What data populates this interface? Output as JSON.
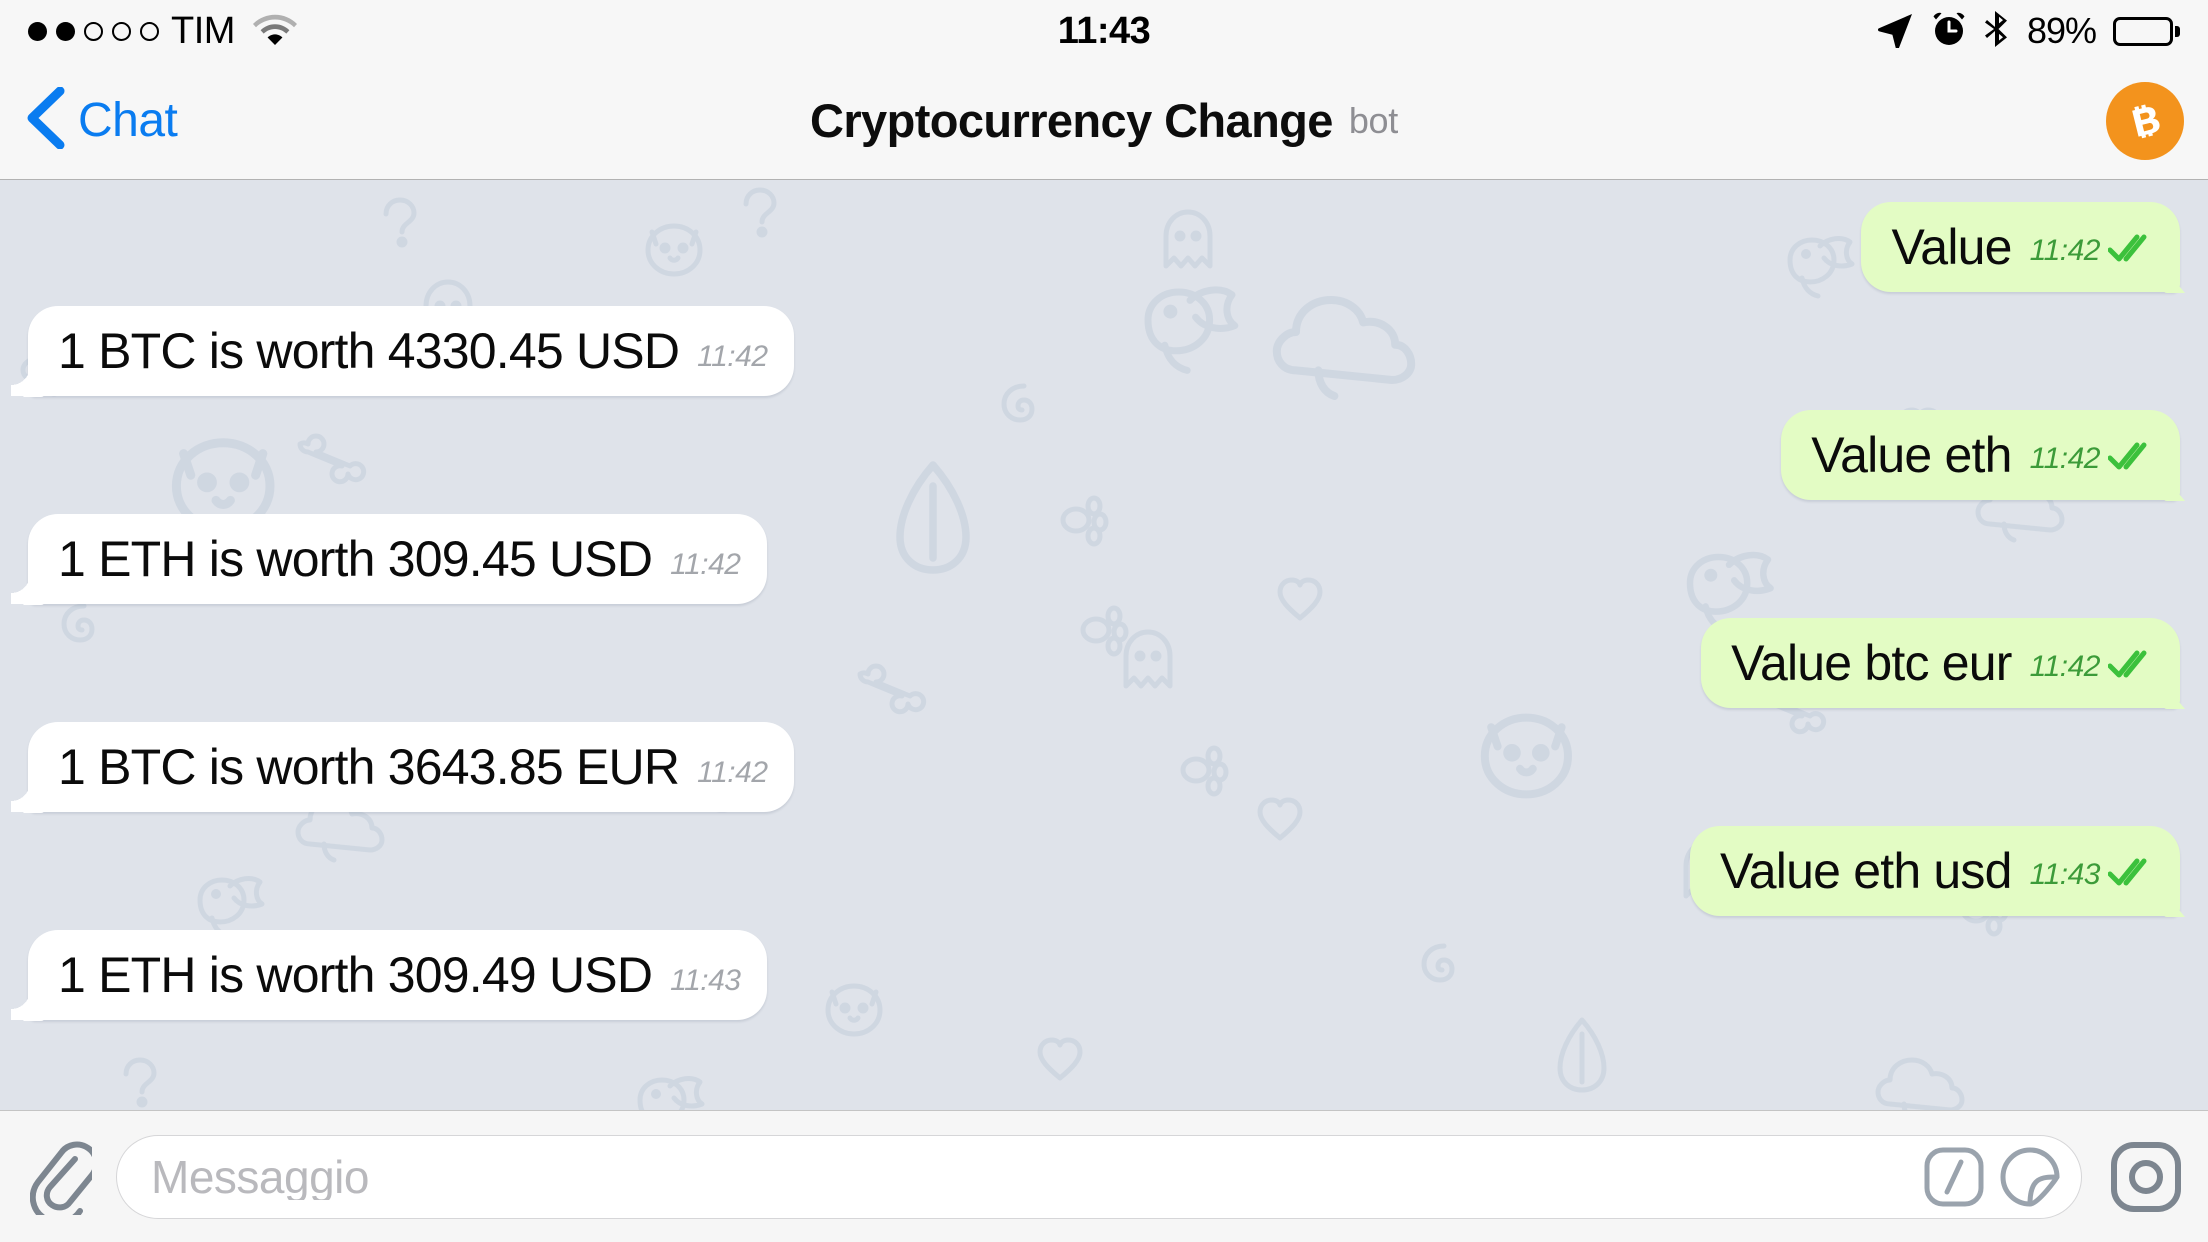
{
  "statusbar": {
    "signal_dots_filled": 2,
    "signal_dots_total": 5,
    "carrier": "TIM",
    "wifi_icon": "wifi-icon",
    "time": "11:43",
    "location_icon": "location-arrow-icon",
    "alarm_icon": "alarm-clock-icon",
    "bluetooth_icon": "bluetooth-icon",
    "battery_percent": "89%",
    "battery_level": 89
  },
  "navbar": {
    "back_icon": "back-chevron-icon",
    "back_label": "Chat",
    "title": "Cryptocurrency Change",
    "badge": "bot",
    "avatar_icon": "bitcoin-icon",
    "avatar_glyph": "Ƀ",
    "avatar_color": "#F3931D",
    "accent_color": "#0A7CF0"
  },
  "chat": {
    "background_color": "#DFE3EA",
    "incoming_bubble_color": "#FFFFFF",
    "outgoing_bubble_color": "#E3FCC4",
    "outgoing_time_color": "#3C9B39",
    "incoming_time_color": "#A3A6AB",
    "check_icon": "double-check-icon",
    "messages": [
      {
        "id": 0,
        "direction": "out",
        "text": "Value",
        "time": "11:42",
        "status": "read"
      },
      {
        "id": 1,
        "direction": "in",
        "text": "1 BTC is worth 4330.45 USD",
        "time": "11:42",
        "status": ""
      },
      {
        "id": 2,
        "direction": "out",
        "text": "Value eth",
        "time": "11:42",
        "status": "read"
      },
      {
        "id": 3,
        "direction": "in",
        "text": "1 ETH is worth 309.45 USD",
        "time": "11:42",
        "status": ""
      },
      {
        "id": 4,
        "direction": "out",
        "text": "Value btc eur",
        "time": "11:42",
        "status": "read"
      },
      {
        "id": 5,
        "direction": "in",
        "text": "1 BTC is worth 3643.85 EUR",
        "time": "11:42",
        "status": ""
      },
      {
        "id": 6,
        "direction": "out",
        "text": "Value eth usd",
        "time": "11:43",
        "status": "read"
      },
      {
        "id": 7,
        "direction": "in",
        "text": "1 ETH is worth 309.49 USD",
        "time": "11:43",
        "status": ""
      }
    ]
  },
  "inputbar": {
    "attach_icon": "paperclip-icon",
    "placeholder": "Messaggio",
    "value": "",
    "command_icon": "slash-command-icon",
    "sticker_icon": "sticker-icon",
    "record_icon": "camera-record-icon"
  }
}
